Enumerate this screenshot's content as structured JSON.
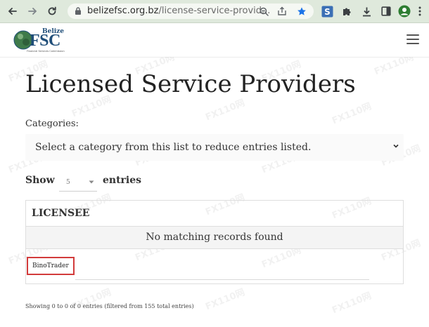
{
  "browser": {
    "url_domain": "belizefsc.org.bz",
    "url_path": "/license-service-provid...",
    "colors": {
      "star": "#1a73e8",
      "chrome_bg": "#dfe9dc"
    },
    "icons": [
      "back-icon",
      "forward-icon",
      "reload-icon",
      "lock-icon",
      "zoom-icon",
      "share-icon",
      "bookmark-star-icon",
      "extension-s-icon",
      "puzzle-icon",
      "download-icon",
      "sidepanel-icon",
      "profile-icon"
    ]
  },
  "site": {
    "logo_top": "Belize",
    "logo_main": "FSC",
    "logo_tagline": "Financial Services Commission",
    "brand_color": "#1f4e79"
  },
  "page": {
    "title": "Licensed Service Providers",
    "categories_label": "Categories:",
    "category_placeholder": "Select a category from this list to reduce entries listed.",
    "show_label": "Show",
    "entries_value": "5",
    "entries_label": "entries",
    "table": {
      "header": "LICENSEE",
      "empty_message": "No matching records found",
      "search_value": "BinoTrader"
    },
    "info": "Showing 0 to 0 of 0 entries (filtered from 155 total entries)"
  },
  "watermark_text": "FX110网"
}
